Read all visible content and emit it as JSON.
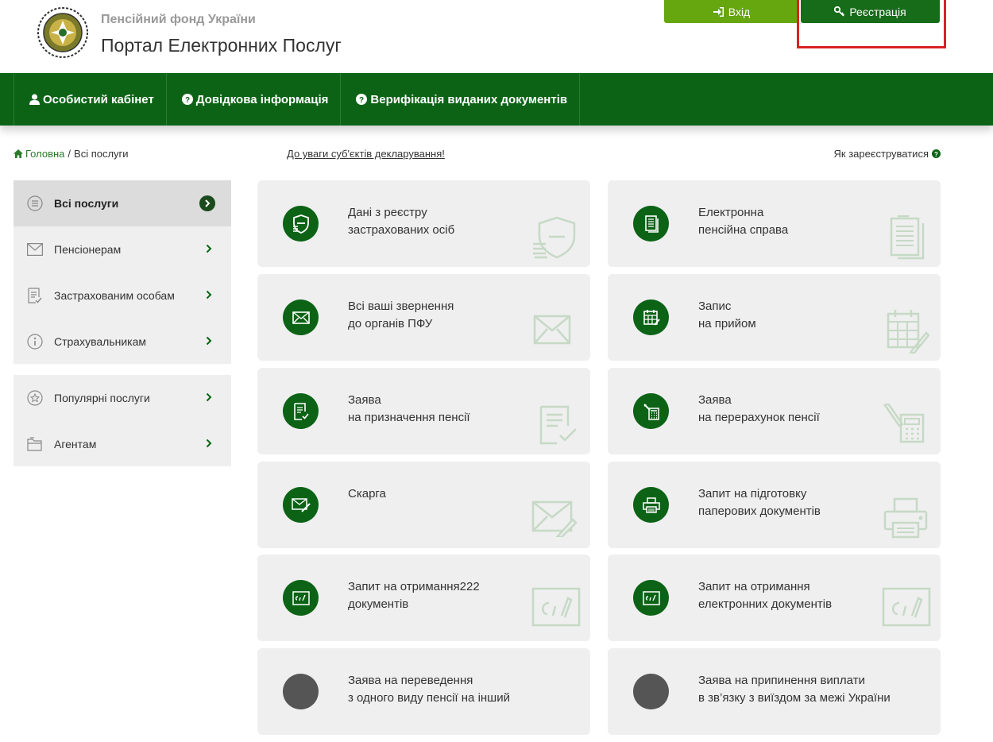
{
  "header": {
    "org_name": "Пенсійний фонд України",
    "portal_title": "Портал Електронних Послуг",
    "login_label": "Вхід",
    "register_label": "Реєстрація"
  },
  "nav": {
    "items": [
      {
        "label": "Особистий кабінет",
        "icon": "user-icon"
      },
      {
        "label": "Довідкова інформація",
        "icon": "question-circle-icon"
      },
      {
        "label": "Верифікація виданих документів",
        "icon": "question-circle-icon"
      }
    ]
  },
  "breadcrumb": {
    "home": "Головна",
    "separator": "/",
    "current": "Всі послуги"
  },
  "notice_link": "До уваги суб'єктів декларування!",
  "how_register": "Як зареєструватися",
  "sidebar": {
    "group1": [
      {
        "label": "Всі послуги",
        "icon": "list-icon",
        "active": true
      },
      {
        "label": "Пенсіонерам",
        "icon": "envelope-icon"
      },
      {
        "label": "Застрахованим особам",
        "icon": "checklist-icon"
      },
      {
        "label": "Страхувальникам",
        "icon": "info-icon"
      }
    ],
    "group2": [
      {
        "label": "Популярні послуги",
        "icon": "star-icon"
      },
      {
        "label": "Агентам",
        "icon": "folder-icon"
      }
    ]
  },
  "cards": [
    {
      "line1": "Дані з реєстру",
      "line2": "застрахованих осіб",
      "icon": "shield-coins-icon"
    },
    {
      "line1": "Електронна",
      "line2": "пенсійна справа",
      "icon": "document-stack-icon"
    },
    {
      "line1": "Всі ваші звернення",
      "line2": "до органів ПФУ",
      "icon": "envelope-icon"
    },
    {
      "line1": "Запис",
      "line2": "на прийом",
      "icon": "calendar-edit-icon"
    },
    {
      "line1": "Заява",
      "line2": "на призначення пенсії",
      "icon": "document-check-icon"
    },
    {
      "line1": "Заява",
      "line2": "на перерахунок пенсії",
      "icon": "calculator-icon"
    },
    {
      "line1": "Скарга",
      "line2": "",
      "icon": "envelope-pen-icon"
    },
    {
      "line1": "Запит на підготовку",
      "line2": "паперових документів",
      "icon": "printer-icon"
    },
    {
      "line1": "Запит на отримання222",
      "line2": "документів",
      "icon": "signature-icon"
    },
    {
      "line1": "Запит на отримання",
      "line2": "електронних документів",
      "icon": "signature-icon"
    },
    {
      "line1": "Заява на переведення",
      "line2": "з одного виду пенсії на інший",
      "icon": "blank-circle"
    },
    {
      "line1": "Заява на припинення виплати",
      "line2": "в зв’язку з виїздом за межі України",
      "icon": "blank-circle"
    }
  ],
  "colors": {
    "primary_green": "#0c6316",
    "light_green": "#66a60f",
    "register_green": "#176c1a",
    "highlight_red": "#d92323",
    "card_bg": "#efefef"
  }
}
